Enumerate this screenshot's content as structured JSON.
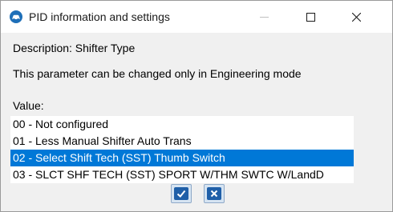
{
  "window": {
    "title": "PID information and settings",
    "app_icon": "car-badge-icon",
    "controls": {
      "minimize": "minimize-icon",
      "maximize": "maximize-icon",
      "close": "close-icon"
    }
  },
  "description": "Description: Shifter Type",
  "note": "This parameter can be changed only in Engineering mode",
  "value_label": "Value:",
  "options": [
    "00 - Not configured",
    "01 - Less Manual Shifter Auto Trans",
    "02 - Select Shift Tech (SST) Thumb Switch",
    "03 - SLCT SHF TECH (SST) SPORT W/THM SWTC W/LandD"
  ],
  "selected_option": "02 - Select Shift Tech (SST) Thumb Switch",
  "buttons": {
    "ok": "checkmark-icon",
    "cancel": "x-icon"
  },
  "colors": {
    "selection": "#0078d7",
    "button_icon": "#1f5fa8"
  }
}
